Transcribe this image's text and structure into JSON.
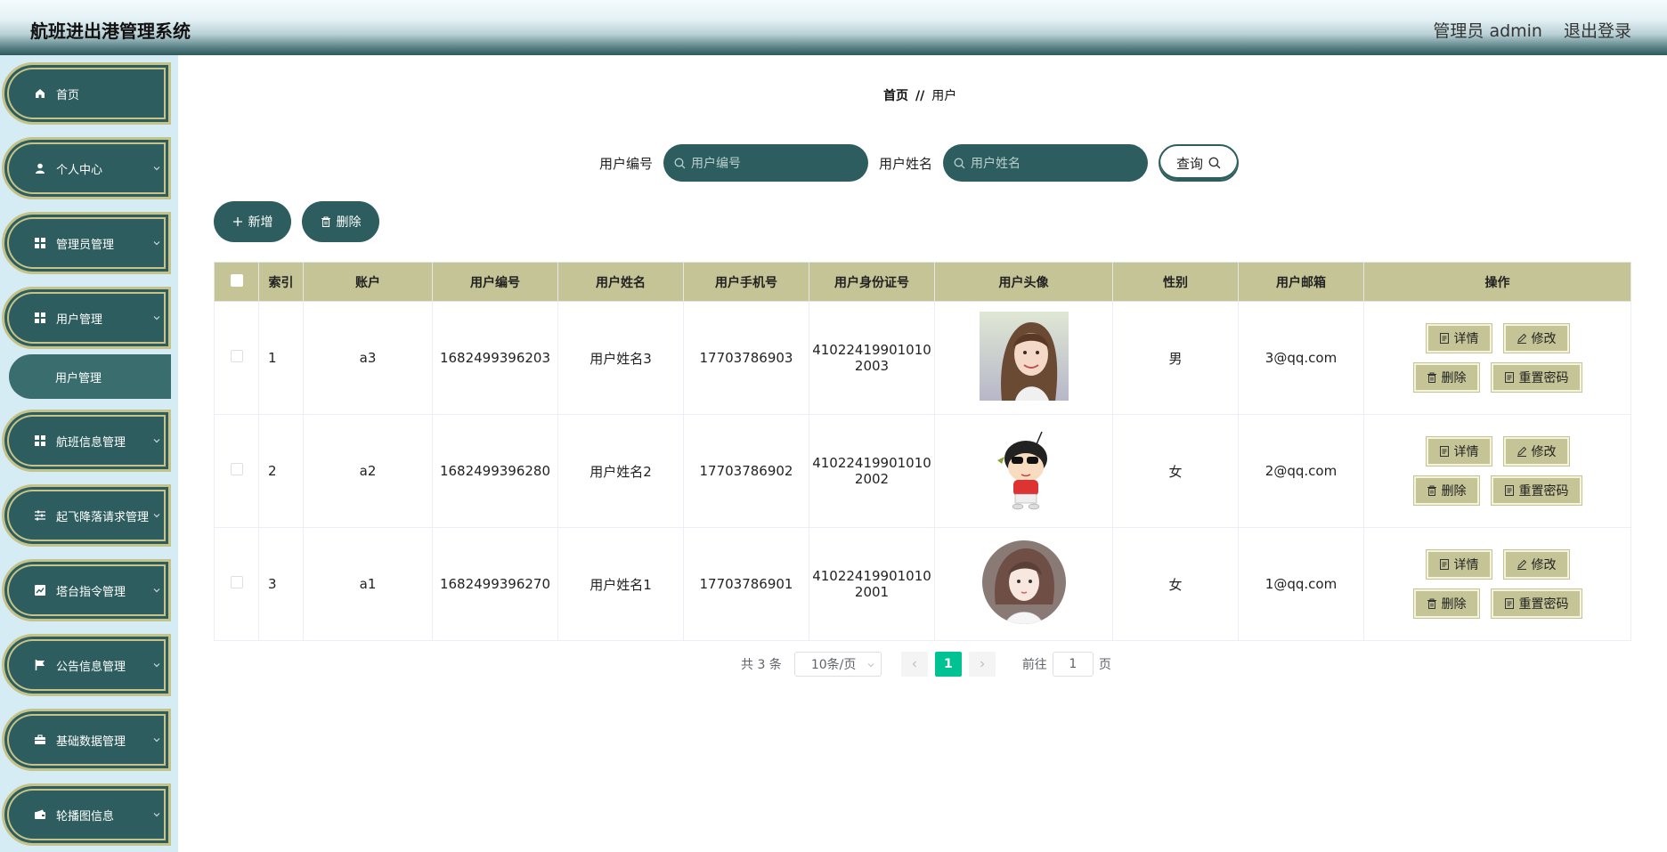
{
  "header": {
    "title": "航班进出港管理系统",
    "user_label": "管理员 admin",
    "logout_label": "退出登录"
  },
  "sidebar": {
    "items": [
      {
        "label": "首页",
        "icon": "home-icon"
      },
      {
        "label": "个人中心",
        "icon": "user-icon"
      },
      {
        "label": "管理员管理",
        "icon": "grid-icon"
      },
      {
        "label": "用户管理",
        "icon": "grid-icon"
      },
      {
        "label": "航班信息管理",
        "icon": "grid-icon"
      },
      {
        "label": "起飞降落请求管理",
        "icon": "sliders-icon"
      },
      {
        "label": "塔台指令管理",
        "icon": "chart-icon"
      },
      {
        "label": "公告信息管理",
        "icon": "flag-icon"
      },
      {
        "label": "基础数据管理",
        "icon": "briefcase-icon"
      },
      {
        "label": "轮播图信息",
        "icon": "wallet-icon"
      }
    ],
    "sub_item": "用户管理"
  },
  "breadcrumb": {
    "home": "首页",
    "sep": "//",
    "current": "用户"
  },
  "search": {
    "label1": "用户编号",
    "placeholder1": "用户编号",
    "label2": "用户姓名",
    "placeholder2": "用户姓名",
    "query_label": "查询"
  },
  "actions": {
    "add_label": "新增",
    "delete_label": "删除"
  },
  "table": {
    "headers": [
      "索引",
      "账户",
      "用户编号",
      "用户姓名",
      "用户手机号",
      "用户身份证号",
      "用户头像",
      "性别",
      "用户邮箱",
      "操作"
    ],
    "rows": [
      {
        "index": "1",
        "account": "a3",
        "code": "1682499396203",
        "name": "用户姓名3",
        "phone": "17703786903",
        "id_card_1": "41022419901010",
        "id_card_2": "2003",
        "avatar": "photo-girl-avatar",
        "gender": "男",
        "email": "3@qq.com"
      },
      {
        "index": "2",
        "account": "a2",
        "code": "1682499396280",
        "name": "用户姓名2",
        "phone": "17703786902",
        "id_card_1": "41022419901010",
        "id_card_2": "2002",
        "avatar": "cartoon-boy-avatar",
        "gender": "女",
        "email": "2@qq.com"
      },
      {
        "index": "3",
        "account": "a1",
        "code": "1682499396270",
        "name": "用户姓名1",
        "phone": "17703786901",
        "id_card_1": "41022419901010",
        "id_card_2": "2001",
        "avatar": "illustrated-girl-avatar",
        "gender": "女",
        "email": "1@qq.com"
      }
    ],
    "op_labels": {
      "detail": "详情",
      "edit": "修改",
      "delete": "删除",
      "reset": "重置密码"
    }
  },
  "pagination": {
    "total": "共 3 条",
    "page_size": "10条/页",
    "current_page": "1",
    "goto_label": "前往",
    "goto_value": "1",
    "page_unit": "页"
  },
  "colors": {
    "primary": "#2d5d5e",
    "accent": "#c4c496",
    "pager_active": "#00c292"
  }
}
